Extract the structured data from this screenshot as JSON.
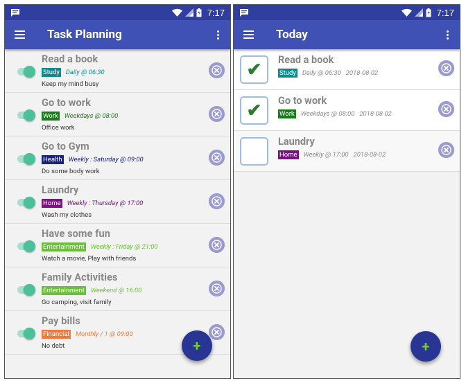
{
  "status": {
    "time": "7:17"
  },
  "planning": {
    "title": "Task Planning",
    "tasks": [
      {
        "name": "Read a book",
        "tag": "Study",
        "tag_color": "#0f8b8d",
        "schedule": "Daily @ 06:30",
        "schedule_color": "#0f8b8d",
        "description": "Keep my mind busy",
        "enabled": true
      },
      {
        "name": "Go to work",
        "tag": "Work",
        "tag_color": "#1b7a1b",
        "schedule": "Weekdays @ 08:00",
        "schedule_color": "#1b7a1b",
        "description": "Office work",
        "enabled": true
      },
      {
        "name": "Go to Gym",
        "tag": "Health",
        "tag_color": "#1a237e",
        "schedule": "Weekly : Saturday @ 09:00",
        "schedule_color": "#1a237e",
        "description": "Do some body work",
        "enabled": true
      },
      {
        "name": "Laundry",
        "tag": "Home",
        "tag_color": "#7b1480",
        "schedule": "Weekly : Thursday @ 17:00",
        "schedule_color": "#7b1480",
        "description": "Wash my clothes",
        "enabled": true
      },
      {
        "name": "Have some fun",
        "tag": "Entertainment",
        "tag_color": "#6cbf3a",
        "schedule": "Weekly : Friday @ 21:00",
        "schedule_color": "#6cbf3a",
        "description": "Watch a movie, Play with friends",
        "enabled": true
      },
      {
        "name": "Family Activities",
        "tag": "Entertainment",
        "tag_color": "#6cbf3a",
        "schedule": "Weekend @ 16:00",
        "schedule_color": "#6cbf3a",
        "description": "Go camping, visit family",
        "enabled": true
      },
      {
        "name": "Pay bills",
        "tag": "Financial",
        "tag_color": "#f07a3a",
        "schedule": "Monthly / 1 @ 09:00",
        "schedule_color": "#f07a3a",
        "description": "No debt",
        "enabled": true
      }
    ],
    "fab_label": "+"
  },
  "today": {
    "title": "Today",
    "tasks": [
      {
        "name": "Read a book",
        "tag": "Study",
        "tag_color": "#0f8b8d",
        "schedule": "Daily @ 06:30",
        "date": "2018-08-02",
        "done": true
      },
      {
        "name": "Go to work",
        "tag": "Work",
        "tag_color": "#1b7a1b",
        "schedule": "Weekdays @ 08:00",
        "date": "2018-08-02",
        "done": true
      },
      {
        "name": "Laundry",
        "tag": "Home",
        "tag_color": "#7b1480",
        "schedule": "Weekly @ 17:00",
        "date": "2018-08-02",
        "done": false
      }
    ],
    "check_mark": "✔",
    "fab_label": "+"
  },
  "colors": {
    "status_bar": "#303f9f",
    "app_bar": "#3f51b5",
    "fab": "#283593",
    "fab_plus": "#6fcf2e",
    "toggle_on": "#4bc09b",
    "remove_icon": "#9b9bd1"
  }
}
